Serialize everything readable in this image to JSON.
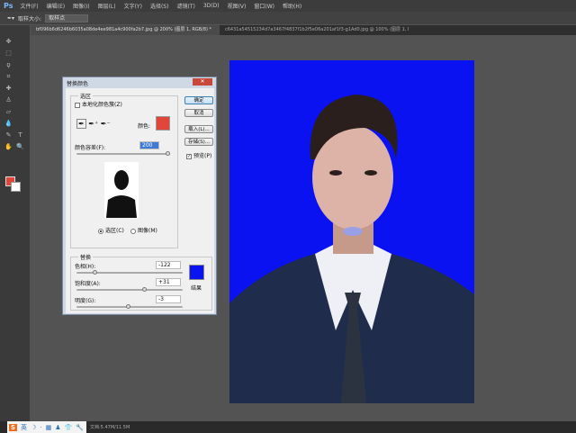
{
  "app": {
    "logo": "Ps",
    "menus": [
      "文件(F)",
      "编辑(E)",
      "图像(I)",
      "图层(L)",
      "文字(Y)",
      "选择(S)",
      "滤镜(T)",
      "3D(D)",
      "视图(V)",
      "窗口(W)",
      "帮助(H)"
    ]
  },
  "options": {
    "sample_size_label": "取样大小:",
    "sample_size_value": "取样点"
  },
  "tabs": [
    {
      "label": "bf096b6d6246b6035a08de4ee981a4c900fa2b7.jpg @ 200% (图层 1, RGB/8) *",
      "active": true
    },
    {
      "label": "c6431a54515234d7a3467f4837f1b2f5e06a201af1f3-g1Ad0.jpg @ 100% (图层 1, RGB/8) *",
      "active": false
    }
  ],
  "colors": {
    "foreground": "#e2453a",
    "background": "#ffffff",
    "photo_bg": "#0b12f2",
    "result": "#0a14f0",
    "selected_color": "#e2453a"
  },
  "dialog": {
    "title": "替换颜色",
    "selection_group": "选区",
    "localized_clusters": "本地化颜色簇(Z)",
    "localized_checked": false,
    "color_label": "颜色:",
    "fuzziness_label": "颜色容差(F):",
    "fuzziness_value": "200",
    "fuzziness_level": 1.0,
    "radio_selection": "选区(C)",
    "radio_image": "图像(M)",
    "radio_selected": "selection",
    "replacement_group": "替换",
    "hue_label": "色相(H):",
    "hue_value": "-122",
    "hue_level": 0.16,
    "saturation_label": "饱和度(A):",
    "saturation_value": "+31",
    "saturation_level": 0.65,
    "lightness_label": "明度(G):",
    "lightness_value": "-3",
    "lightness_level": 0.49,
    "result_label": "结果",
    "ok": "确定",
    "cancel": "取消",
    "load": "载入(L)...",
    "save": "存储(S)...",
    "preview": "预览(P)",
    "preview_checked": true
  },
  "status": {
    "text": "文档:5.47M/11.5M",
    "ime": [
      "S",
      "英",
      "☽",
      "·",
      "▦",
      "♟",
      "👕",
      "🔧"
    ]
  }
}
